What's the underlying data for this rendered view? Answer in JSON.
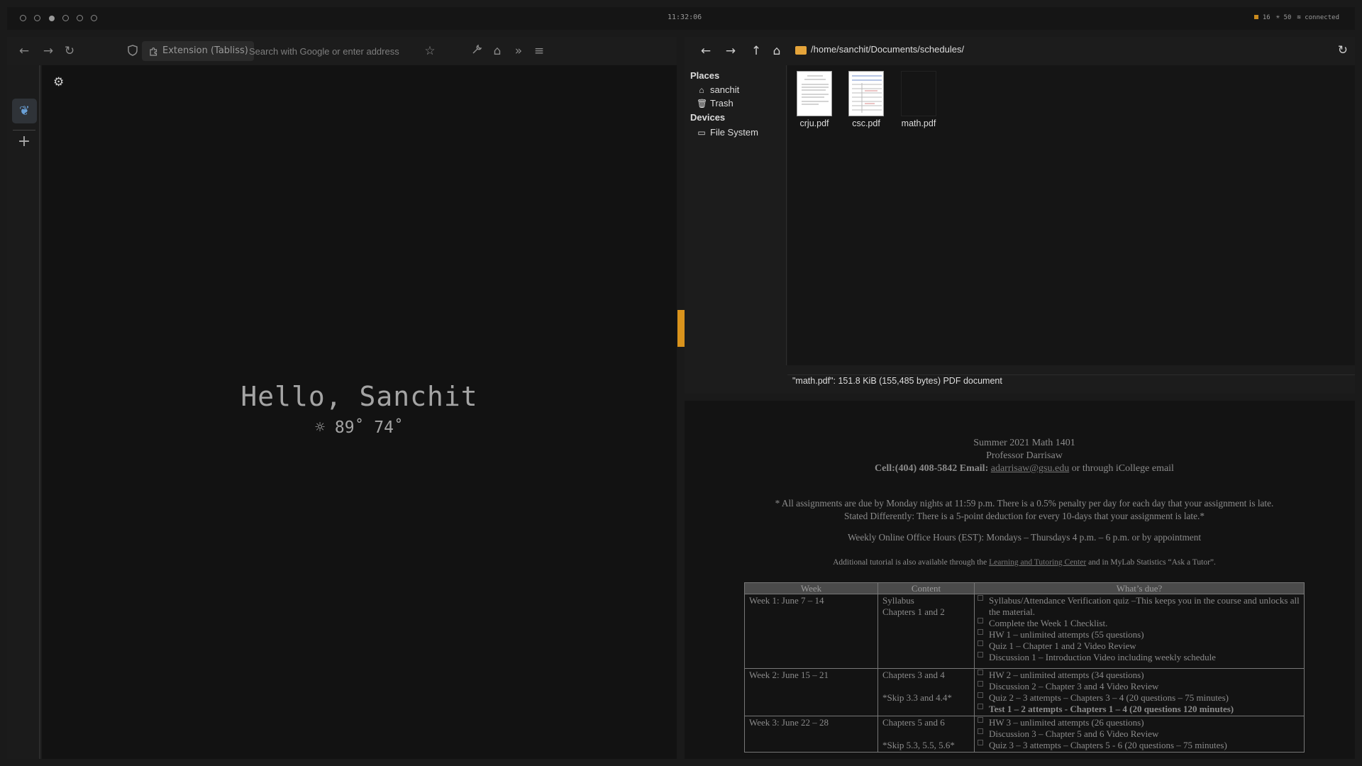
{
  "statusbar": {
    "clock": "11:32:06",
    "battery": "16",
    "brightness": "50",
    "network": "connected"
  },
  "browser": {
    "extension_label": "Extension (Tabliss)",
    "address_placeholder": "Search with Google or enter address",
    "greeting": "Hello, Sanchit",
    "weather_high": "89˚",
    "weather_low": "74˚"
  },
  "filemanager": {
    "path": "/home/sanchit/Documents/schedules/",
    "places_heading": "Places",
    "places": [
      "sanchit",
      "Trash"
    ],
    "devices_heading": "Devices",
    "devices": [
      "File System"
    ],
    "files": [
      "crju.pdf",
      "csc.pdf",
      "math.pdf"
    ],
    "status": "\"math.pdf\": 151.8 KiB (155,485 bytes) PDF document"
  },
  "pdf": {
    "line1": "Summer 2021 Math 1401",
    "line2": "Professor Darrisaw",
    "contact_prefix": "Cell:(404) 408-5842 Email:",
    "email": "adarrisaw@gsu.edu",
    "contact_suffix": " or through iCollege email",
    "policy1": "* All assignments are due by Monday nights at 11:59 p.m. There is a 0.5% penalty per day for each day that your assignment is late.",
    "policy2": "Stated Differently: There is a 5-point deduction for every 10-days that your assignment is late.*",
    "office_hours": "Weekly Online Office Hours (EST): Mondays – Thursdays 4 p.m. –  6 p.m. or by appointment",
    "tutorial_prefix": "Additional tutorial is also available through the ",
    "tutorial_link": "Learning and Tutoring Center",
    "tutorial_suffix": " and in MyLab Statistics “Ask a Tutor”.",
    "table_headers": [
      "Week",
      "Content",
      "What’s due?"
    ],
    "rows": [
      {
        "week": "Week 1: June 7 – 14",
        "content": [
          "Syllabus",
          "Chapters 1 and 2"
        ],
        "due": [
          "Syllabus/Attendance Verification quiz –This keeps you in the course and unlocks all the material.",
          "Complete the Week 1 Checklist.",
          "HW 1 – unlimited attempts (55 questions)",
          "Quiz 1 – Chapter 1 and 2 Video Review",
          "Discussion 1 – Introduction Video including weekly schedule"
        ]
      },
      {
        "week": "Week 2: June 15 – 21",
        "content": [
          "Chapters 3 and 4",
          "*Skip 3.3 and 4.4*"
        ],
        "due": [
          "HW 2 – unlimited attempts (34 questions)",
          "Discussion 2 – Chapter 3 and 4 Video Review",
          "Quiz 2 – 3 attempts – Chapters 3 – 4 (20 questions – 75 minutes)",
          "Test 1 – 2 attempts - Chapters 1 – 4 (20 questions 120 minutes)"
        ]
      },
      {
        "week": "Week 3: June 22 – 28",
        "content": [
          "Chapters 5 and 6",
          "*Skip 5.3, 5.5, 5.6*"
        ],
        "due": [
          "HW 3 – unlimited attempts (26 questions)",
          "Discussion 3 – Chapter 5 and 6 Video Review",
          "Quiz 3 – 3 attempts – Chapters 5 - 6 (20 questions – 75 minutes)"
        ]
      }
    ]
  },
  "colors": {
    "accent": "#d9931c",
    "folder": "#e5a43a",
    "sidebar_active_icon": "#6aa0d6"
  }
}
